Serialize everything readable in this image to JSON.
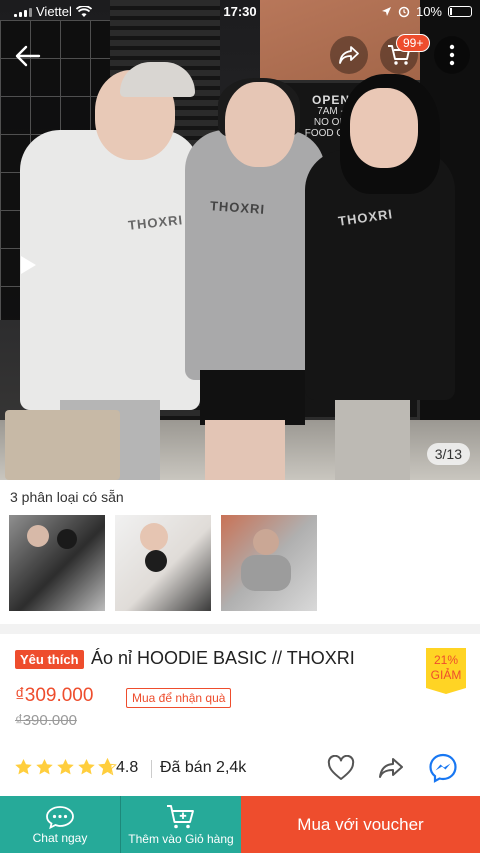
{
  "status_bar": {
    "carrier": "Viettel",
    "time": "17:30",
    "battery": "10%"
  },
  "header": {
    "cart_badge": "99+",
    "image_counter": "3/13"
  },
  "hero_prints": [
    "THOXRI",
    "THOXRI",
    "THOXRI"
  ],
  "door_sign": {
    "title": "OPEN DAI",
    "hours": "7AM - 10PM",
    "notice": "NO OUTSIDE FOOD OR DRINK"
  },
  "variants": {
    "title": "3 phân loại có sẵn",
    "count": 3
  },
  "product": {
    "badge": "Yêu thích",
    "title": "Áo nỉ HOODIE BASIC // THOXRI",
    "discount_percent": "21%",
    "discount_label": "GIẢM",
    "price": "₫309.000",
    "promo_tag": "Mua để nhận quà",
    "old_price": "₫390.000",
    "rating": "4.8",
    "rating_value": 4.8,
    "sold": "Đã bán 2,4k"
  },
  "bottom_bar": {
    "chat_label": "Chat ngay",
    "cart_label": "Thêm vào Giỏ hàng",
    "buy_label": "Mua với voucher"
  },
  "colors": {
    "brand": "#ee4d2d",
    "teal": "#26aa99",
    "star": "#ffce3d",
    "discount_bg": "#ffd424"
  },
  "icons": [
    "back-arrow-icon",
    "share-icon",
    "cart-icon",
    "more-vertical-icon",
    "play-icon",
    "star-icon",
    "heart-icon",
    "share-arrow-icon",
    "messenger-icon",
    "chat-icon",
    "add-to-cart-icon"
  ]
}
